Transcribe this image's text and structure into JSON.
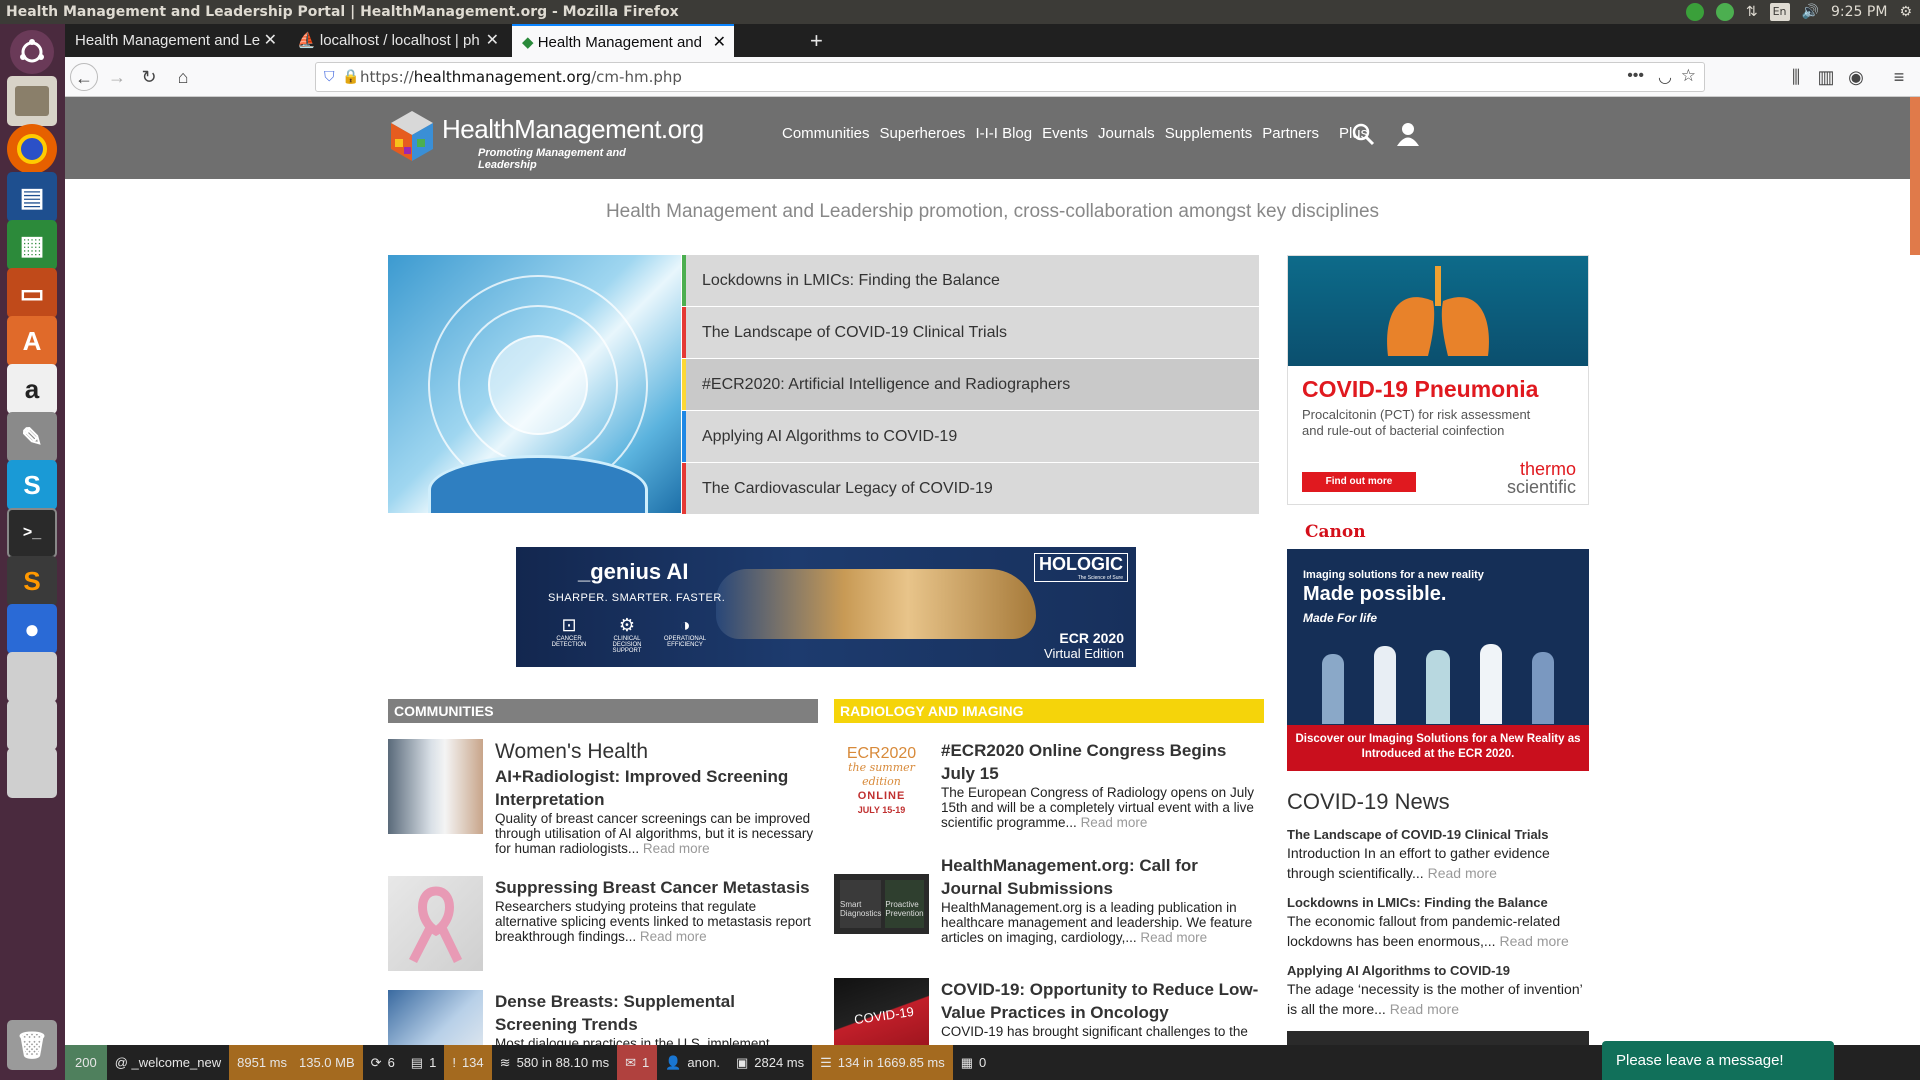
{
  "window": {
    "title": "Health Management and Leadership Portal | HealthManagement.org - Mozilla Firefox"
  },
  "system_tray": {
    "language": "En",
    "time": "9:25 PM"
  },
  "browser": {
    "tabs": [
      {
        "label": "Health Management and Le"
      },
      {
        "label": "localhost / localhost | ph"
      },
      {
        "label": "Health Management and"
      }
    ],
    "url_prefix": "https://",
    "url_domain": "healthmanagement.org",
    "url_path": "/cm-hm.php"
  },
  "site": {
    "logo": {
      "name": "HealthManagement.org",
      "tagline": "Promoting Management and Leadership"
    },
    "nav": [
      "Communities",
      "Superheroes",
      "I-I-I Blog",
      "Events",
      "Journals",
      "Supplements",
      "Partners",
      "Plus"
    ],
    "tagline": "Health Management and Leadership promotion, cross-collaboration amongst key disciplines",
    "hero_items": [
      {
        "title": "Lockdowns in LMICs: Finding the Balance",
        "color": "#4caf50"
      },
      {
        "title": "The Landscape of COVID-19 Clinical Trials",
        "color": "#e53935"
      },
      {
        "title": "#ECR2020: Artificial Intelligence and Radiographers",
        "color": "#fdd835"
      },
      {
        "title": "Applying AI Algorithms to COVID-19",
        "color": "#1e88e5"
      },
      {
        "title": "The Cardiovascular Legacy of COVID-19",
        "color": "#e53935"
      }
    ],
    "banner": {
      "brand": "_genius AI",
      "slogan": "SHARPER. SMARTER. FASTER.",
      "features": [
        "CANCER DETECTION",
        "CLINICAL DECISION SUPPORT",
        "OPERATIONAL EFFICIENCY"
      ],
      "company": "HOLOGIC",
      "company_sub": "The Science of Sure",
      "event": "ECR 2020",
      "event_sub": "Virtual Edition"
    },
    "communities": {
      "header": "COMMUNITIES",
      "articles": [
        {
          "category": "Women's Health",
          "title": "AI+Radiologist: Improved Screening Interpretation",
          "text": "Quality of breast cancer screenings can be improved through utilisation of AI algorithms, but it is necessary for human radiologists...",
          "more": "Read more"
        },
        {
          "title": "Suppressing Breast Cancer Metastasis",
          "text": "Researchers studying proteins that regulate alternative splicing events linked to metastasis report breakthrough findings...",
          "more": "Read more"
        },
        {
          "title": "Dense Breasts: Supplemental Screening Trends",
          "text": "Most dialogue practices in the U.S. implement"
        }
      ]
    },
    "radiology": {
      "header": "RADIOLOGY AND IMAGING",
      "articles": [
        {
          "title": "#ECR2020 Online Congress Begins July 15",
          "text": "The European Congress of Radiology opens on July 15th and will be a completely virtual event with a live scientific programme...",
          "more": "Read more",
          "thumb": {
            "l1": "ECR2020",
            "l2": "the summer edition",
            "l3": "ONLINE",
            "l4": "JULY 15-19"
          }
        },
        {
          "title": "HealthManagement.org: Call for Journal Submissions",
          "text": "HealthManagement.org is a leading publication in healthcare management and leadership. We feature articles on imaging, cardiology,...",
          "more": "Read more",
          "thumb": {
            "l1": "Smart Diagnostics",
            "l2": "Proactive Prevention"
          }
        },
        {
          "title": "COVID-19: Opportunity to Reduce Low-Value Practices in Oncology",
          "text": "COVID-19 has brought significant challenges to the",
          "thumb": {
            "l1": "COVID-19"
          }
        }
      ]
    },
    "ad_thermo": {
      "title": "COVID-19 Pneumonia",
      "subtitle": "Procalcitonin (PCT) for risk assessment and rule-out of bacterial coinfection",
      "button": "Find out more",
      "brand1": "thermo",
      "brand2": "scientific"
    },
    "ad_canon": {
      "logo": "Canon",
      "line1": "Imaging solutions for a new reality",
      "line2": "Made possible.",
      "line3": "Made For life",
      "footer": "Discover our Imaging Solutions for a New Reality as Introduced at the ECR 2020."
    },
    "covid_news": {
      "header": "COVID-19 News",
      "items": [
        {
          "title": "The Landscape of COVID-19 Clinical Trials",
          "text": "Introduction In an effort to gather evidence through scientifically...",
          "more": "Read more"
        },
        {
          "title": "Lockdowns in LMICs: Finding the Balance",
          "text": "The economic fallout from pandemic-related lockdowns has been enormous,...",
          "more": "Read more"
        },
        {
          "title": "Applying AI Algorithms to COVID-19",
          "text": "The adage ‘necessity is the mother of invention’ is all the more...",
          "more": "Read more"
        }
      ]
    }
  },
  "debug_bar": {
    "status": "200",
    "route": "@ _welcome_new",
    "time": "8951 ms",
    "memory": "135.0 MB",
    "forms": "6",
    "docs": "1",
    "warnings": "134",
    "db": "580 in 88.10 ms",
    "messages": "1",
    "user": "anon.",
    "twig": "2824 ms",
    "cache": "134 in 1669.85 ms",
    "misc": "0"
  },
  "chat": {
    "label": "Please leave a message!"
  }
}
